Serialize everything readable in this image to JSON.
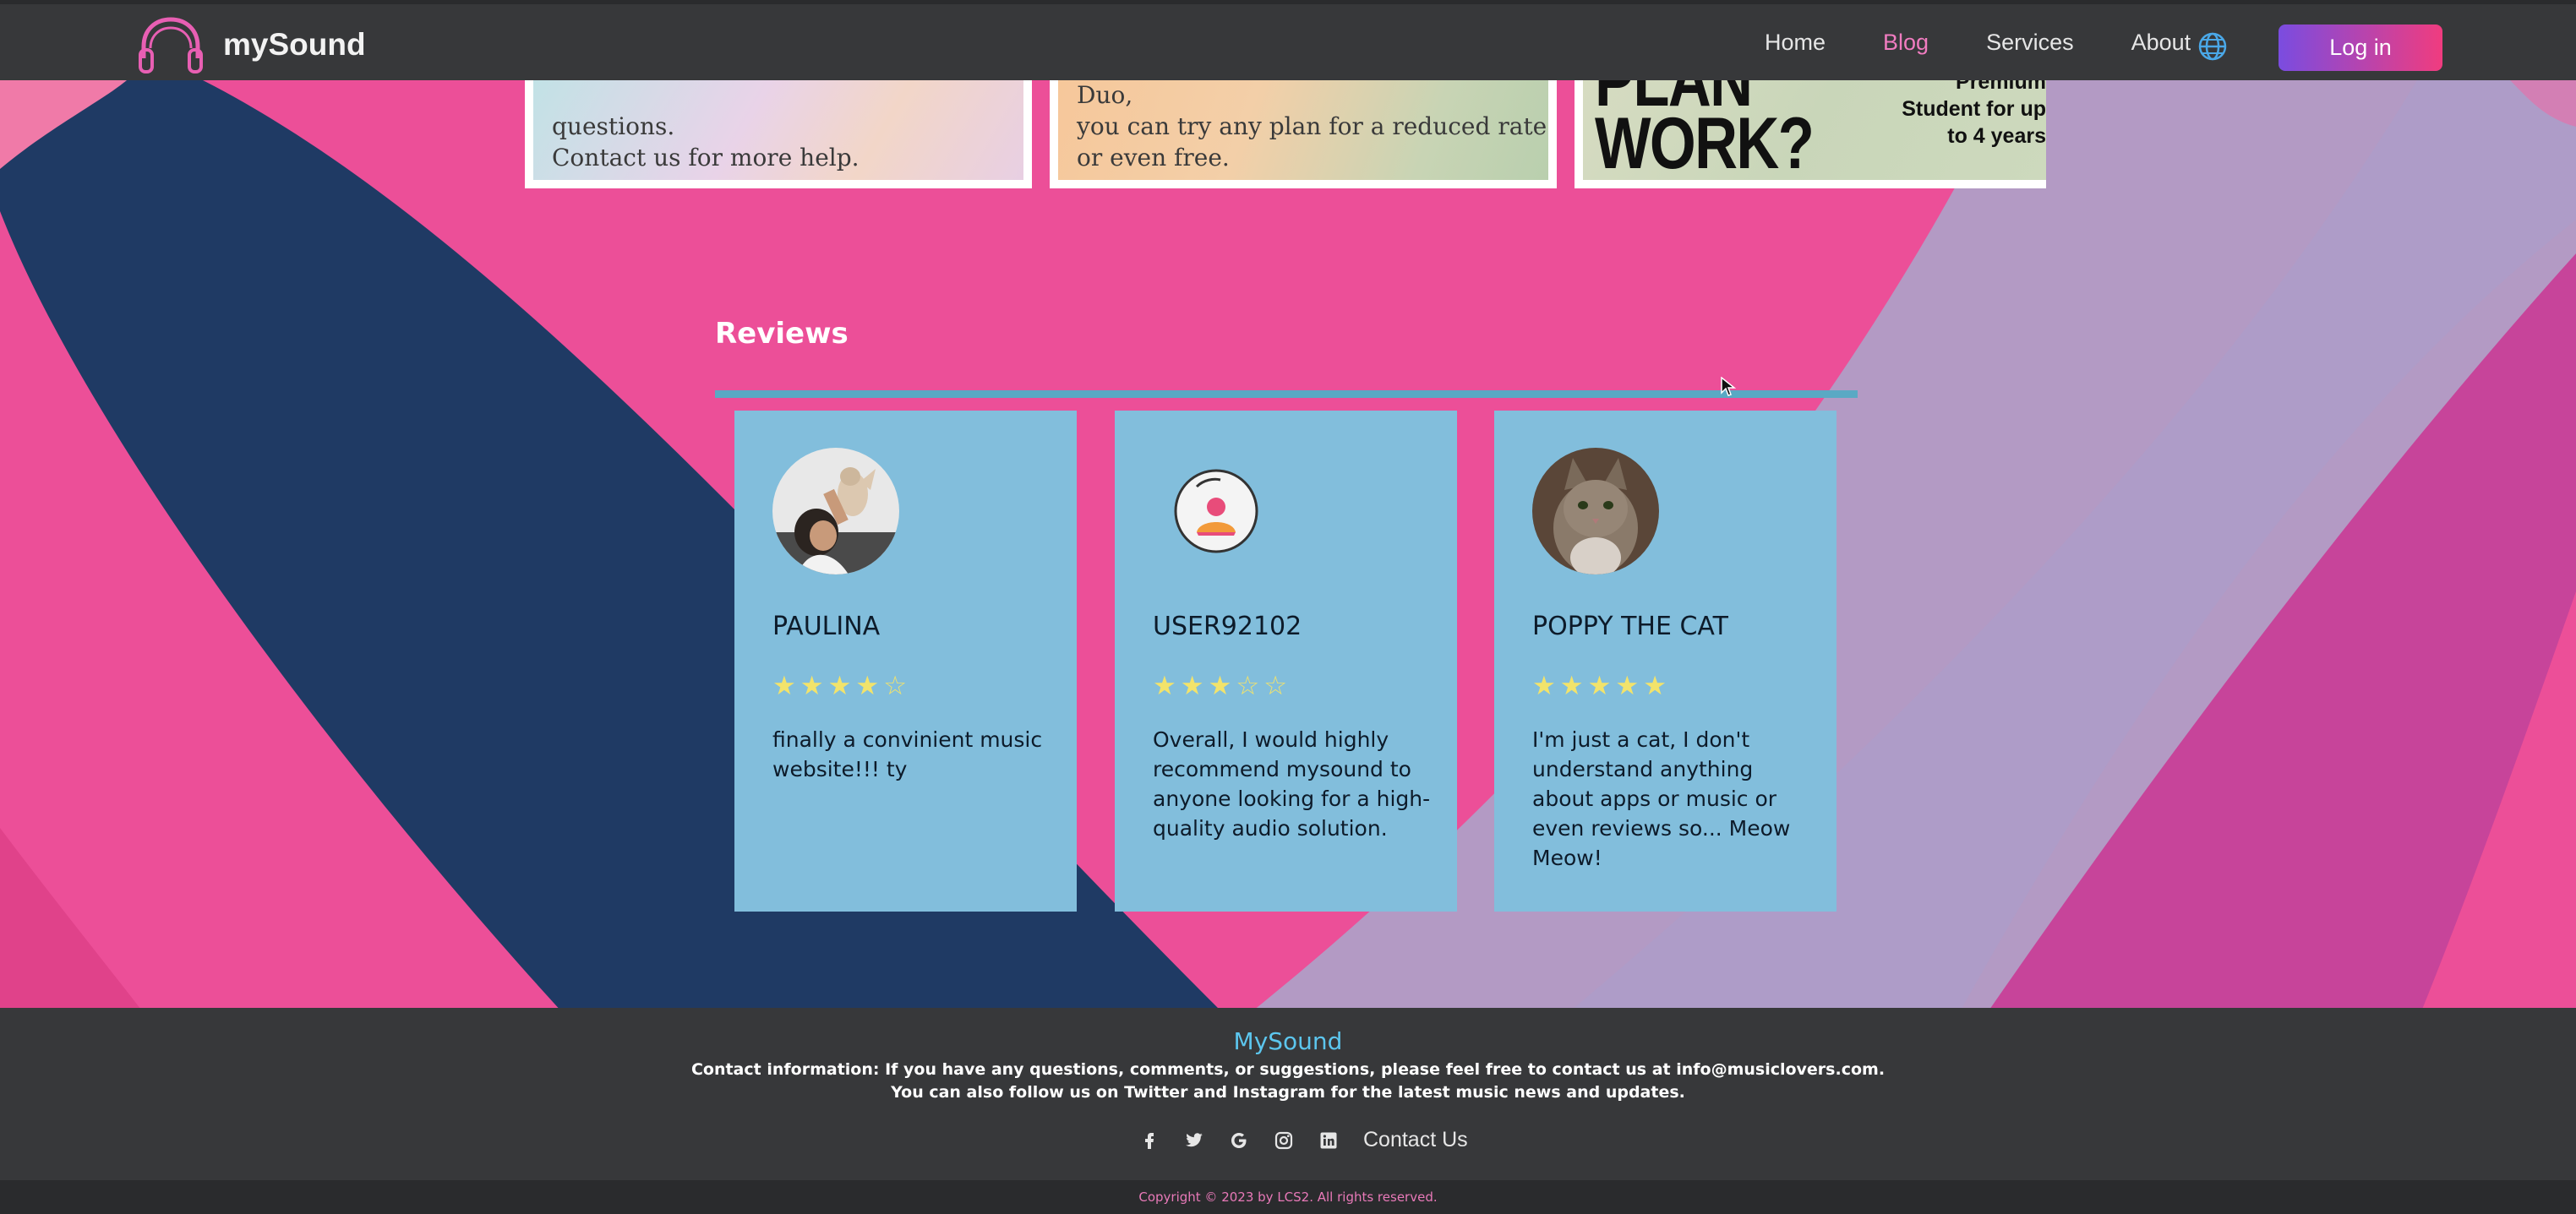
{
  "nav": {
    "brand": "mySound",
    "links": [
      "Home",
      "Blog",
      "Services",
      "About"
    ],
    "active": "Blog",
    "login": "Log in",
    "globe_icon": "globe-icon",
    "logo_icon": "headphones-icon"
  },
  "blog_cards": [
    {
      "lines": [
        "questions.",
        "Contact us for more help."
      ]
    },
    {
      "lines": [
        "of Premium plan such as Family or Duo,",
        "you can try any plan for a reduced rate",
        "or even free."
      ]
    },
    {
      "big_text": [
        "PLAN",
        "WORK?"
      ],
      "small_lines": [
        "Premium",
        "Student for up",
        "to 4 years"
      ]
    }
  ],
  "reviews": {
    "title": "Reviews",
    "items": [
      {
        "name": "PAULINA",
        "rating": 4,
        "text": "finally a convinient music website!!! ty",
        "avatar": "photo-avatar-person-with-cat"
      },
      {
        "name": "USER92102",
        "rating": 3,
        "text": "Overall, I would highly recommend mysound to anyone looking for a high-quality audio solution.",
        "avatar": "default-user-icon"
      },
      {
        "name": "POPPY THE CAT",
        "rating": 5,
        "text": "I'm just a cat, I don't understand anything about apps or music or even reviews so... Meow Meow!",
        "avatar": "photo-avatar-cat"
      }
    ]
  },
  "footer": {
    "brand": "MySound",
    "line1": "Contact information: If you have any questions, comments, or suggestions, please feel free to contact us at info@musiclovers.com.",
    "line2": "You can also follow us on Twitter and Instagram for the latest music news and updates.",
    "socials": [
      "facebook-icon",
      "twitter-icon",
      "google-icon",
      "instagram-icon",
      "linkedin-icon"
    ],
    "contact": "Contact Us",
    "copyright": "Copyright © 2023 by LCS2. All rights reserved."
  },
  "colors": {
    "accent_pink": "#f07cc0",
    "brand_blue": "#5cc6ee",
    "card_blue": "#82bedc",
    "star_yellow": "#f2e36b"
  }
}
